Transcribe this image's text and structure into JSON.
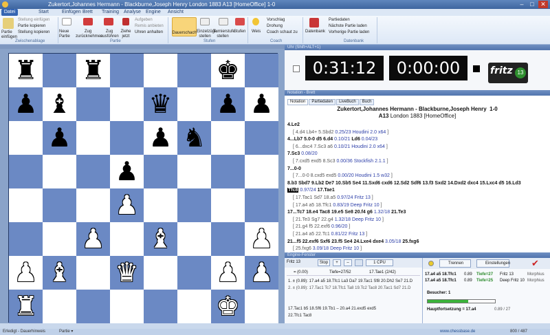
{
  "window": {
    "title": "Zukertort,Johannes Hermann - Blackburne,Joseph Henry  London 1883  A13  [HomeOffice]  1-0",
    "min": "–",
    "max": "□",
    "close": "✕"
  },
  "ribbon_tabs": [
    "Datei",
    "Start",
    "Einfügen",
    "Brett",
    "Training",
    "Analyse",
    "Engine",
    "Ansicht"
  ],
  "ribbon": {
    "paste": "Partie einfügen",
    "stellung_einfuegen": "Stellung einfügen",
    "partie_kopieren": "Partie kopieren",
    "stellung_kopieren": "Stellung kopieren",
    "grp_zwischenablage": "Zwischenablage",
    "neue_partie": "Neue Partie",
    "zug_zuruecknehmen": "Zug zurücknehmen",
    "zug_ausfuehren": "Zug ausführen",
    "ziehe_jetzt": "Ziehe jetzt",
    "aufgeben": "Aufgeben",
    "remis": "Remis anbieten",
    "unten_anhalten": "Uhren anhalten",
    "grp_partie": "Partie",
    "dauerschach": "Dauerschach",
    "einzelzuege": "Einzelzüge stellen",
    "turnierstufe": "Turnierstufe stellen",
    "stufen": "Stufen",
    "grp_stufen": "Stufen",
    "weis": "Weis",
    "vorschlag": "Vorschlag",
    "drohung": "Drohung",
    "coach": "Coach schaut zu",
    "grp_coach": "Coach",
    "datenbank": "Datenbank",
    "partiedaten": "Partiedaten",
    "naechste": "Nächste Partie laden",
    "vorherige": "Vorherige Partie laden",
    "grp_datenbank": "Datenbank"
  },
  "board": {
    "header": "",
    "pieces": [
      [
        "r",
        "",
        "r",
        "",
        "",
        "",
        "k",
        ""
      ],
      [
        "p",
        "b",
        "",
        "",
        "q",
        "",
        "p",
        "p"
      ],
      [
        "",
        "p",
        "",
        "",
        "p",
        "n",
        "",
        ""
      ],
      [
        "",
        "",
        "",
        "p",
        "",
        "",
        "",
        ""
      ],
      [
        "",
        "",
        "",
        "P",
        "",
        "",
        "",
        ""
      ],
      [
        "",
        "",
        "P",
        "",
        "B",
        "",
        "",
        "P"
      ],
      [
        "P",
        "B",
        "",
        "Q",
        "",
        "",
        "P",
        "P"
      ],
      [
        "R",
        "",
        "",
        "",
        "",
        "",
        "K",
        ""
      ]
    ]
  },
  "clock": {
    "header": "Uhr (Shift+ALT+1)",
    "white": "0:31:12",
    "black": "0:00:00",
    "logo": "fritz",
    "logo_num": "13"
  },
  "notation": {
    "header": "Notation - Brett",
    "tabs": [
      "Notation",
      "Partiedaten",
      "LiveBuch",
      "Buch"
    ],
    "white": "Zukertort,Johannes Hermann",
    "black": "Blackburne,Joseph Henry",
    "result": "1-0",
    "eco": "A13",
    "event": "London 1883 [HomeOffice]",
    "lines": [
      [
        [
          "mv",
          "4.Le2"
        ]
      ],
      [
        [
          "vr",
          "[ 4.d4 Lb4+ 5.Sbd2 "
        ],
        [
          "ev",
          "0.25/23 Houdini 2.0 x64"
        ],
        [
          "vr",
          " ]"
        ]
      ],
      [
        [
          "mv",
          "4...Lb7 5.0-0 d5 6.d4 "
        ],
        [
          "ev",
          "0.10/21"
        ],
        [
          "mv",
          " Ld6 "
        ],
        [
          "ev",
          "0.04/23"
        ]
      ],
      [
        [
          "vr",
          "[ 6...dxc4 7.Sc3 a6 "
        ],
        [
          "ev",
          "0.10/21 Houdini 2.0 x64"
        ],
        [
          "vr",
          " ]"
        ]
      ],
      [
        [
          "mv",
          "7.Sc3 "
        ],
        [
          "ev",
          "0.08/20"
        ]
      ],
      [
        [
          "vr",
          "[ 7.cxd5 exd5 8.Sc3 "
        ],
        [
          "ev",
          "0.00/36 Stockfish 2.1.1"
        ],
        [
          "vr",
          " ]"
        ]
      ],
      [
        [
          "mv",
          "7...0-0"
        ]
      ],
      [
        [
          "vr",
          "[ 7...0-0 8.cxd5 exd5 "
        ],
        [
          "ev",
          "0.00/20 Houdini 1.5 w32"
        ],
        [
          "vr",
          " ]"
        ]
      ],
      [
        [
          "mv",
          "8.b3 Sbd7 9.Lb2 De7 10.Sb5 Se4 11.Sxd6 cxd6 12.Sd2 Sdf6 13.f3 Sxd2 14.Dxd2 dxc4 15.Lxc4 d5 16.Ld3"
        ]
      ],
      [
        [
          "hl",
          "Tfc8"
        ],
        [
          "ev",
          " 0.97/24"
        ],
        [
          "mv",
          " 17.Tae1"
        ]
      ],
      [
        [
          "vr",
          "[ 17.Tac1 Sd7 18.a5 "
        ],
        [
          "ev",
          "0.97/24 Fritz 13"
        ],
        [
          "vr",
          " ]"
        ]
      ],
      [
        [
          "vr",
          "[ 17.a4 a5 18.Tfc1 "
        ],
        [
          "ev",
          "0.83/19 Deep Fritz 10"
        ],
        [
          "vr",
          " ]"
        ]
      ],
      [
        [
          "mv",
          "17...Tc7 18.e4 Tac8 19.e5 Se8 20.f4 g6 "
        ],
        [
          "ev",
          "1.32/18"
        ],
        [
          "mv",
          " 21.Te3"
        ]
      ],
      [
        [
          "vr",
          "[ 21.Te3 Sg7 22.g4 "
        ],
        [
          "ev",
          "1.32/18 Deep Fritz 10"
        ],
        [
          "vr",
          " ]"
        ]
      ],
      [
        [
          "vr",
          "[ 21.g4 f5 22.exf6 "
        ],
        [
          "ev",
          "0.96/20"
        ],
        [
          "vr",
          " ]"
        ]
      ],
      [
        [
          "vr",
          "[ 21.a4 a5 22.Tc1 "
        ],
        [
          "ev",
          "0.81/22 Fritz 13"
        ],
        [
          "vr",
          " ]"
        ]
      ],
      [
        [
          "mv",
          "21...f5 22.exf6 Sxf6 23.f5 Se4 24.Lxe4 dxe4 "
        ],
        [
          "ev",
          "3.05/18"
        ],
        [
          "mv",
          " 25.fxg6"
        ]
      ],
      [
        [
          "vr",
          "[ 25.fxg6 "
        ],
        [
          "ev",
          "3.09/18 Deep Fritz 10"
        ],
        [
          "vr",
          " ]"
        ]
      ]
    ]
  },
  "engine": {
    "header": "Engine-Fenster",
    "name": "Fritz 13",
    "stop": "Stop",
    "plus": "+",
    "minus": "–",
    "cpu_btn": "1 CPU",
    "eval": "= (0.00)",
    "depth": "Tiefe=27/52",
    "move": "17.Tae1 (2/42)",
    "l1": "1. ± (0.89): 17.a4 a5 18.Tfc1 La3 Da7 19.Tac1 Sf8 20.Dh2 Se7 21.D",
    "l2": "2. ± (0.89): 17.Tac1 Tc7 18.Tfc1 Ta8 19.Tc2 Tac8 20.Tac1 Sd7 21.D",
    "l3": "17.Tac1 b5 18.Sf6 19.Tb1 – 20.a4 21.exd5 exd5",
    "l4": "22.Tfc1 Tac8"
  },
  "kibitzer": {
    "header": "",
    "reward_btn": "Trennen",
    "settings_btn": "Einstellungen",
    "r1a": "17.a4 a5 18.Tfc1",
    "r1b": "0.89",
    "r1c": "Tiefe=27",
    "r1d": "Fritz 13",
    "r1e": "Morphius",
    "r2a": "17.a4 a5 18.Tfc1",
    "r2b": "0.89",
    "r2c": "Tiefe=25",
    "r2d": "Deep Fritz 10",
    "r2e": "Morphius",
    "besucher": "Besucher: 1",
    "haupt": "Hauptfortsetzung = 17.a4",
    "haupt_b": "0.89 / 27",
    "progress": 0.6
  },
  "status": {
    "left": "Erledigt - Dauerhinweis",
    "mid": "Partie ▾",
    "right": "www.chessbase.de",
    "zoom": "800 / 487"
  }
}
